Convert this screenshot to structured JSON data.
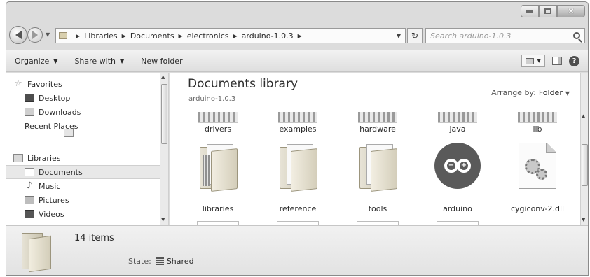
{
  "window": {
    "caption": {
      "minimize": "minimize-icon",
      "maximize": "maximize-icon",
      "close": "close-icon"
    }
  },
  "address": {
    "breadcrumbs": [
      "Libraries",
      "Documents",
      "electronics",
      "arduino-1.0.3"
    ],
    "search_placeholder": "Search arduino-1.0.3"
  },
  "toolbar": {
    "organize": "Organize",
    "share_with": "Share with",
    "new_folder": "New folder"
  },
  "nav": {
    "favorites_header": "Favorites",
    "favorites": [
      "Desktop",
      "Downloads",
      "Recent Places"
    ],
    "libraries_header": "Libraries",
    "libraries": [
      "Documents",
      "Music",
      "Pictures",
      "Videos"
    ],
    "selected": "Documents"
  },
  "content": {
    "title": "Documents library",
    "subtitle": "arduino-1.0.3",
    "arrange_label": "Arrange by:",
    "arrange_value": "Folder",
    "top_row": [
      "drivers",
      "examples",
      "hardware",
      "java",
      "lib"
    ],
    "items": [
      {
        "label": "libraries",
        "kind": "folder"
      },
      {
        "label": "reference",
        "kind": "folder"
      },
      {
        "label": "tools",
        "kind": "folder"
      },
      {
        "label": "arduino",
        "kind": "application"
      },
      {
        "label": "cygiconv-2.dll",
        "kind": "dll"
      }
    ]
  },
  "details": {
    "count": "14 items",
    "state_label": "State:",
    "state_value": "Shared"
  },
  "colors": {
    "window_chrome": "#dcdcdc",
    "content_bg": "#ffffff",
    "selected_bg": "#e8e8e8"
  }
}
